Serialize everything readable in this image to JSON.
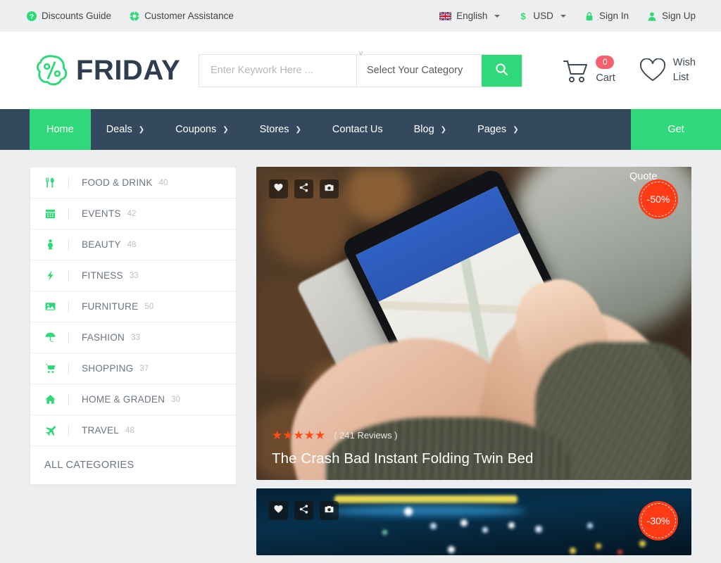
{
  "topbar": {
    "left_items": [
      {
        "label": "Discounts Guide",
        "icon": "question-circle-icon"
      },
      {
        "label": "Customer Assistance",
        "icon": "lifebuoy-icon"
      }
    ],
    "language": {
      "label": "English",
      "icon": "uk-flag-icon"
    },
    "currency": {
      "label": "USD",
      "icon": "dollar-icon"
    },
    "sign_in": {
      "label": "Sign In",
      "icon": "lock-icon"
    },
    "sign_up": {
      "label": "Sign Up",
      "icon": "user-icon"
    }
  },
  "header": {
    "logo_text": "FRIDAY",
    "logo_icon": "price-tag-percent-icon",
    "search_placeholder": "Enter Keywork Here ...",
    "search_value": "",
    "category_selected": "Select Your Category",
    "search_icon": "search-icon",
    "cart": {
      "count": "0",
      "label": "Cart",
      "icon": "shopping-cart-icon"
    },
    "wishlist": {
      "label": "Wish\nList",
      "line1": "Wish",
      "line2": "List",
      "icon": "heart-outline-icon"
    }
  },
  "nav": {
    "items": [
      {
        "label": "Home",
        "has_dropdown": false,
        "active": true
      },
      {
        "label": "Deals",
        "has_dropdown": true,
        "active": false
      },
      {
        "label": "Coupons",
        "has_dropdown": true,
        "active": false
      },
      {
        "label": "Stores",
        "has_dropdown": true,
        "active": false
      },
      {
        "label": "Contact Us",
        "has_dropdown": false,
        "active": false
      },
      {
        "label": "Blog",
        "has_dropdown": true,
        "active": false
      },
      {
        "label": "Pages",
        "has_dropdown": true,
        "active": false
      }
    ],
    "cta_line1": "Get",
    "cta_line2": "Quote"
  },
  "sidebar": {
    "categories": [
      {
        "name": "FOOD & DRINK",
        "count": "40",
        "icon": "cutlery-icon"
      },
      {
        "name": "EVENTS",
        "count": "42",
        "icon": "calendar-icon"
      },
      {
        "name": "BEAUTY",
        "count": "48",
        "icon": "person-icon"
      },
      {
        "name": "FITNESS",
        "count": "33",
        "icon": "bolt-icon"
      },
      {
        "name": "FURNITURE",
        "count": "50",
        "icon": "image-icon"
      },
      {
        "name": "FASHION",
        "count": "33",
        "icon": "umbrella-icon"
      },
      {
        "name": "SHOPPING",
        "count": "37",
        "icon": "cart-icon"
      },
      {
        "name": "HOME & GRADEN",
        "count": "30",
        "icon": "home-icon"
      },
      {
        "name": "TRAVEL",
        "count": "48",
        "icon": "plane-icon"
      }
    ],
    "all_categories_label": "ALL CATEGORIES"
  },
  "products": [
    {
      "discount": "-50%",
      "stars": "★★★★★",
      "reviews": "( 241 Reviews )",
      "title": "The Crash Bad Instant Folding Twin Bed",
      "actions": [
        "heart-icon",
        "share-icon",
        "camera-icon"
      ]
    },
    {
      "discount": "-30%",
      "actions": [
        "heart-icon",
        "share-icon",
        "camera-icon"
      ]
    }
  ],
  "colors": {
    "accent_green": "#2fd878",
    "nav_dark": "#34495e",
    "badge_red": "#ff3b16",
    "cart_badge": "#f4616c",
    "page_bg": "#eceef0",
    "star_orange": "#ff4a1c"
  }
}
